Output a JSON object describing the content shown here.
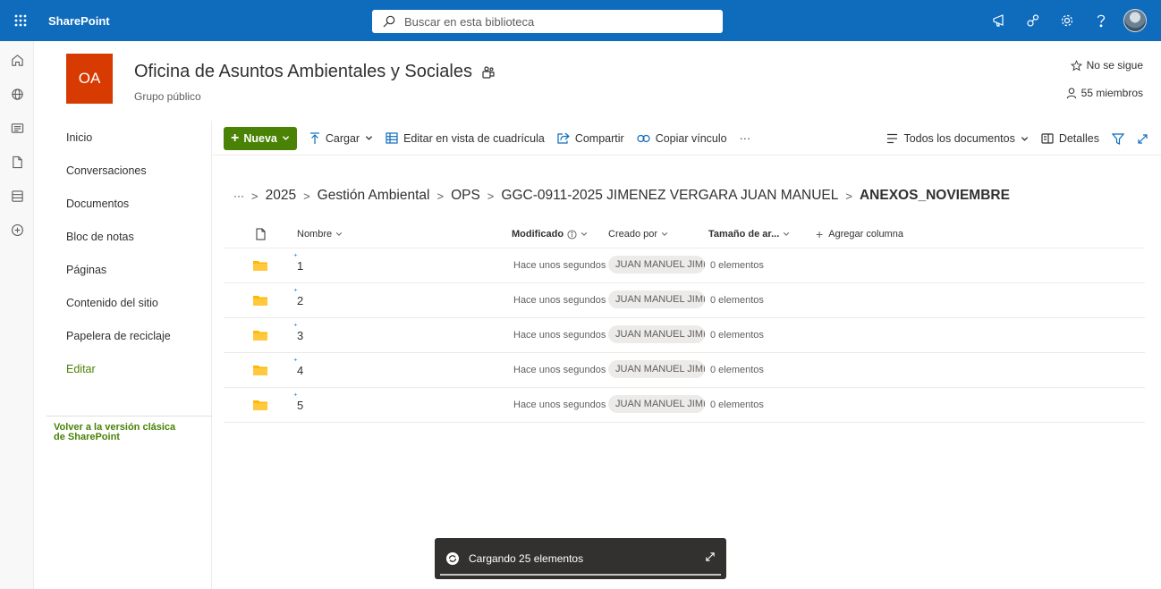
{
  "suite": {
    "app_name": "SharePoint",
    "search_placeholder": "Buscar en esta biblioteca"
  },
  "site": {
    "logo_text": "OA",
    "title": "Oficina de Asuntos Ambientales y Sociales",
    "subtitle": "Grupo público",
    "follow_label": "No se sigue",
    "members_label": "55 miembros",
    "logo_color": "#d83b01"
  },
  "nav": {
    "items": [
      {
        "label": "Inicio"
      },
      {
        "label": "Conversaciones"
      },
      {
        "label": "Documentos"
      },
      {
        "label": "Bloc de notas"
      },
      {
        "label": "Páginas"
      },
      {
        "label": "Contenido del sitio"
      },
      {
        "label": "Papelera de reciclaje"
      },
      {
        "label": "Editar"
      }
    ],
    "classic_link": "Volver a la versión clásica de SharePoint"
  },
  "commands": {
    "new": "Nueva",
    "upload": "Cargar",
    "grid_edit": "Editar en vista de cuadrícula",
    "share": "Compartir",
    "copy_link": "Copiar vínculo",
    "more": "···",
    "view": "Todos los documentos",
    "details": "Detalles"
  },
  "breadcrumb": {
    "ellipsis": "···",
    "items": [
      "2025",
      "Gestión Ambiental",
      "OPS",
      "GGC-0911-2025 JIMENEZ VERGARA JUAN MANUEL"
    ],
    "current": "ANEXOS_NOVIEMBRE"
  },
  "columns": {
    "name": "Nombre",
    "modified": "Modificado",
    "created_by": "Creado por",
    "size": "Tamaño de ar...",
    "add": "Agregar columna"
  },
  "rows": [
    {
      "name": "1",
      "modified": "Hace unos segundos",
      "created_by": "JUAN MANUEL JIMENEZ",
      "size": "0 elementos"
    },
    {
      "name": "2",
      "modified": "Hace unos segundos",
      "created_by": "JUAN MANUEL JIMENEZ",
      "size": "0 elementos"
    },
    {
      "name": "3",
      "modified": "Hace unos segundos",
      "created_by": "JUAN MANUEL JIMENEZ",
      "size": "0 elementos"
    },
    {
      "name": "4",
      "modified": "Hace unos segundos",
      "created_by": "JUAN MANUEL JIMENEZ",
      "size": "0 elementos"
    },
    {
      "name": "5",
      "modified": "Hace unos segundos",
      "created_by": "JUAN MANUEL JIMENEZ",
      "size": "0 elementos"
    }
  ],
  "toast": {
    "message": "Cargando 25 elementos"
  },
  "colors": {
    "suitebar": "#0f6cbd",
    "accent_green": "#498205",
    "folder": "#ffb900"
  }
}
